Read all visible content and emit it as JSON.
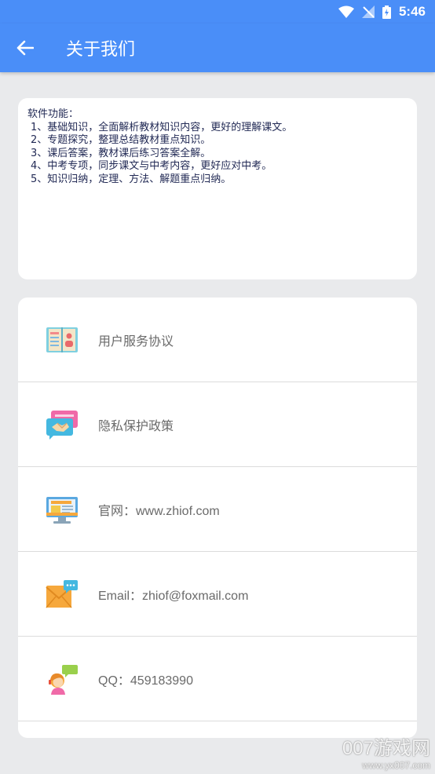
{
  "status_bar": {
    "time": "5:46"
  },
  "app_bar": {
    "title": "关于我们"
  },
  "features": {
    "heading": "软件功能：",
    "items": [
      "1、基础知识，全面解析教材知识内容，更好的理解课文。",
      "2、专题探究，整理总结教材重点知识。",
      "3、课后答案，教材课后练习答案全解。",
      "4、中考专项，同步课文与中考内容，更好应对中考。",
      "5、知识归纳，定理、方法、解题重点归纳。"
    ]
  },
  "links": [
    {
      "label": "用户服务协议",
      "icon": "book-icon"
    },
    {
      "label": "隐私保护政策",
      "icon": "handshake-icon"
    },
    {
      "label": "官网：www.zhiof.com",
      "icon": "computer-icon"
    },
    {
      "label": "Email：zhiof@foxmail.com",
      "icon": "envelope-icon"
    },
    {
      "label": "QQ：459183990",
      "icon": "chat-person-icon"
    }
  ],
  "watermark": {
    "main": "007游戏网",
    "sub": "www.yx007.com"
  },
  "colors": {
    "primary": "#4a8ef8",
    "background": "#e9eaec"
  }
}
